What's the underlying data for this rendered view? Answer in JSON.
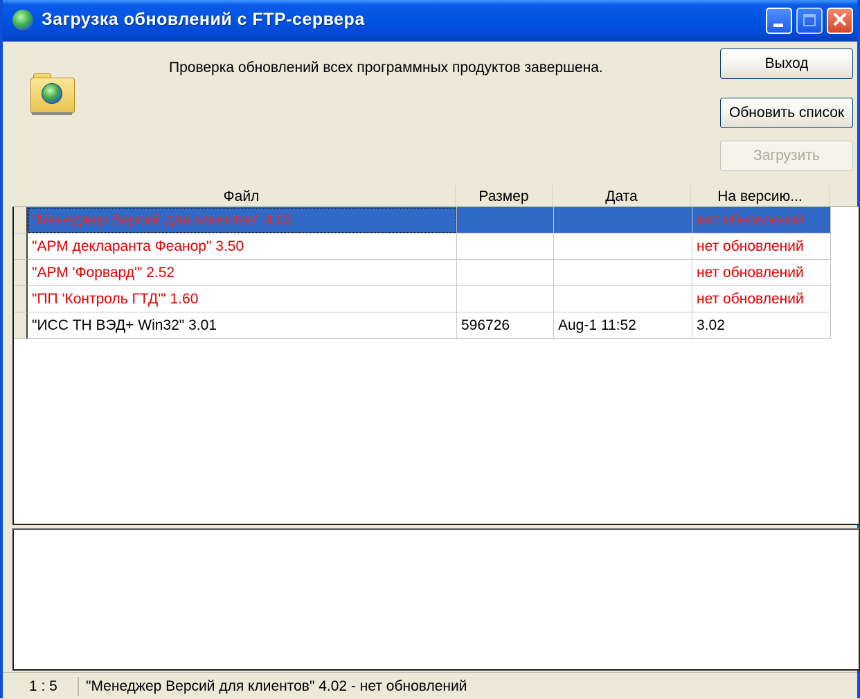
{
  "window": {
    "title": "Загрузка обновлений с FTP-сервера",
    "icon": "globe-icon",
    "controls": {
      "minimize": "minimize-icon",
      "maximize": "maximize-icon",
      "close": "close-icon",
      "close_glyph": "✕"
    }
  },
  "message": "Проверка обновлений всех программных продуктов завершена.",
  "buttons": {
    "exit": "Выход",
    "refresh": "Обновить список",
    "download": "Загрузить"
  },
  "table": {
    "columns": [
      "Файл",
      "Размер",
      "Дата",
      "На версию..."
    ],
    "rows": [
      {
        "file": "\"Менеджер Версий для клиентов\" 4.02",
        "size": "",
        "date": "",
        "version": "нет обновлений",
        "color": "#e00000",
        "selected": true
      },
      {
        "file": "\"АРМ декларанта Феанор\" 3.50",
        "size": "",
        "date": "",
        "version": "нет обновлений",
        "color": "#e00000",
        "selected": false
      },
      {
        "file": "\"АРМ 'Форвард'\" 2.52",
        "size": "",
        "date": "",
        "version": "нет обновлений",
        "color": "#e00000",
        "selected": false
      },
      {
        "file": "\"ПП 'Контроль ГТД'\" 1.60",
        "size": "",
        "date": "",
        "version": "нет обновлений",
        "color": "#e00000",
        "selected": false
      },
      {
        "file": "\"ИСС ТН ВЭД+ Win32\" 3.01",
        "size": "596726",
        "date": "Aug-1  11:52",
        "version": "3.02",
        "color": "#000000",
        "selected": false
      }
    ]
  },
  "statusbar": {
    "position": "1 : 5",
    "text": "\"Менеджер Версий для клиентов\" 4.02 - нет обновлений"
  },
  "colors": {
    "titlebar": "#0054e3",
    "window_bg": "#ece9d8",
    "selection": "#3169c6",
    "no_update": "#e00000"
  }
}
